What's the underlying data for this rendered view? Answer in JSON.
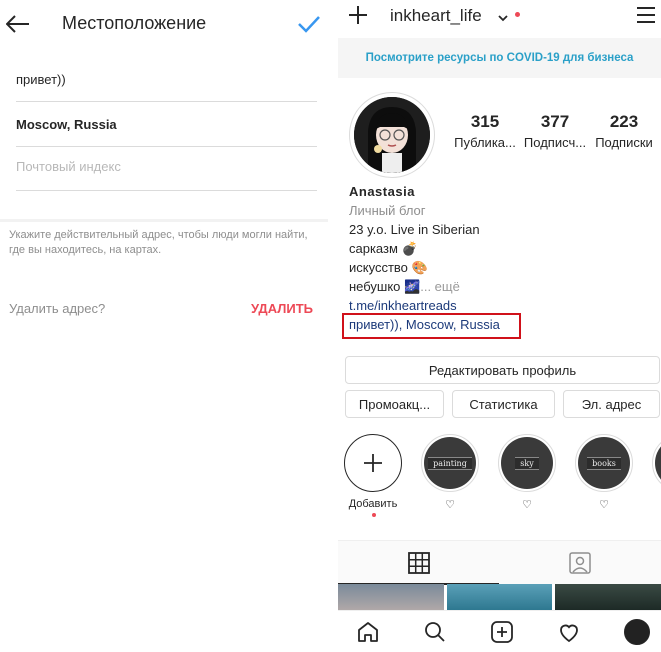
{
  "left_screen": {
    "title": "Местоположение",
    "fields": {
      "street": "привет))",
      "city": "Moscow, Russia",
      "postal_placeholder": "Почтовый индекс"
    },
    "hint": "Укажите действительный адрес, чтобы люди могли найти, где вы находитесь, на картах.",
    "delete_question": "Удалить адрес?",
    "delete_label": "УДАЛИТЬ",
    "colors": {
      "accent": "#3897f0",
      "danger": "#ed4956"
    }
  },
  "right_screen": {
    "username": "inkheart_life",
    "covid_banner": "Посмотрите ресурсы по COVID-19 для бизнеса",
    "stats": [
      {
        "value": "315",
        "label": "Публика..."
      },
      {
        "value": "377",
        "label": "Подписч..."
      },
      {
        "value": "223",
        "label": "Подписки"
      }
    ],
    "bio": {
      "name": "Anastasia",
      "category": "Личный блог",
      "line1": "23 y.o. Live in Siberian",
      "line2": "сарказм 💣",
      "line3": "искусство 🎨",
      "line4": "небушко 🌌",
      "more": "... ещё",
      "link": "t.me/inkheartreads",
      "location": "привет)), Moscow, Russia"
    },
    "buttons": {
      "edit_profile": "Редактировать профиль",
      "promo": "Промоакц...",
      "stats": "Статистика",
      "email": "Эл. адрес"
    },
    "highlights": [
      {
        "label": "Добавить",
        "tag": ""
      },
      {
        "label": "♡",
        "tag": "painting"
      },
      {
        "label": "♡",
        "tag": "sky"
      },
      {
        "label": "♡",
        "tag": "books"
      },
      {
        "label": "",
        "tag": ""
      }
    ],
    "icons": {
      "top_left": "plus-icon",
      "top_right": "hamburger-menu-icon",
      "tabs": [
        "grid-icon",
        "tagged-person-icon"
      ],
      "nav": [
        "home-icon",
        "search-icon",
        "new-post-icon",
        "heart-icon",
        "profile-avatar-icon"
      ]
    },
    "colors": {
      "banner_text": "#2aa0c8",
      "link": "#1c3a7a",
      "highlight_box": "#d0111a"
    }
  }
}
